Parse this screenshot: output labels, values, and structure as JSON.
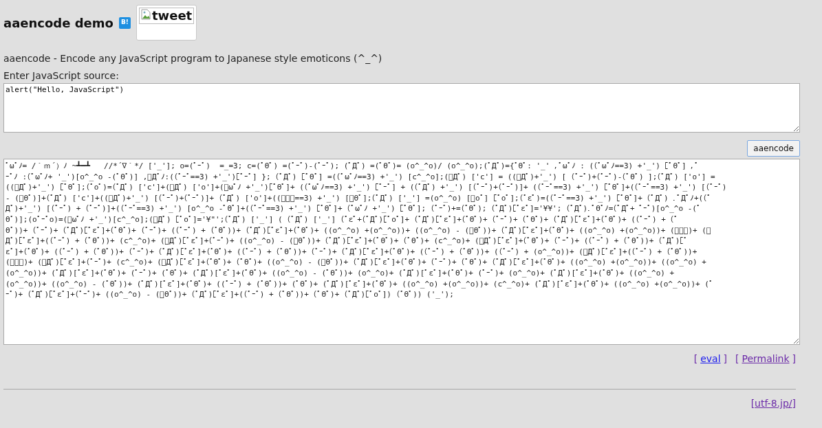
{
  "header": {
    "title": "aaencode demo",
    "bookmark_badge": "B!",
    "tweet_image_alt": "tweet"
  },
  "description": "aaencode - Encode any JavaScript program to Japanese style emoticons (^_^)",
  "source": {
    "label": "Enter JavaScript source:",
    "value": "alert(\"Hello, JavaScript\")"
  },
  "encode_button": "aaencode",
  "output": {
    "lines": [
      {
        "parts": [
          "ﾟωﾟﾉ= /｀ｍ´）ﾉ ~┻━┻   //*´∇｀",
          "*/ ['_']; o=(ﾟｰﾟ)  =_=3; c=(ﾟΘﾟ) =(ﾟｰﾟ)-(ﾟｰﾟ); (ﾟДﾟ) =(ﾟΘﾟ)= (o^_^o)/ (o^_^o);(ﾟДﾟ)={ﾟΘﾟ: '_' ,ﾟωﾟﾉ : ((ﾟωﾟﾉ==3) +'_') [ﾟΘﾟ] ,ﾟ"
        ]
      },
      {
        "parts": [
          "ｰﾟﾉ :(ﾟωﾟﾉ+ '_')[o^_^o -(ﾟΘﾟ)] ,ﾟДﾟﾉ:((ﾟｰﾟ==3) +'_')[ﾟｰﾟ] }; (ﾟДﾟ) [ﾟΘﾟ] =((ﾟωﾟﾉ==3) +'_') [c^_^o];(ﾟДﾟ) ['c'] = ((ﾟДﾟ)+'_') [ (ﾟｰﾟ)+(ﾟｰﾟ)-(ﾟΘﾟ) ];(ﾟДﾟ) ['o'] ="
        ]
      },
      {
        "parts": [
          "((ﾟДﾟ)+'_') [ﾟΘﾟ];(ﾟoﾟ)=(ﾟДﾟ) ['c']+(ﾟДﾟ) ['o']+(ﾟωﾟﾉ +'_')[ﾟΘﾟ]+ ((ﾟωﾟﾉ==3) +'_') [ﾟｰﾟ] + ((ﾟДﾟ) +'_') [(ﾟｰﾟ)+(ﾟｰﾟ)]+ ((ﾟｰﾟ==3) +'_') [ﾟΘﾟ]+((ﾟｰﾟ==3) +'_') [(ﾟｰﾟ)"
        ]
      },
      {
        "parts": [
          "- (ﾟΘﾟ)]+(ﾟДﾟ) ['c']+((ﾟДﾟ)+'_') [(ﾟｰﾟ)+(ﾟｰﾟ)]+ (ﾟДﾟ) ['o']+((ﾟｰﾟ==3) +'_') [ﾟΘﾟ];(ﾟДﾟ) ['_'] =(o^_^o) [ﾟoﾟ] [ﾟoﾟ];(ﾟεﾟ)=((ﾟｰﾟ==3) +'_') [ﾟΘﾟ]+ (ﾟДﾟ) .ﾟДﾟﾉ+((ﾟ"
        ]
      },
      {
        "parts": [
          "Дﾟ)+'_') [(ﾟｰﾟ) + (ﾟｰﾟ)]+((ﾟｰﾟ==3) +'_') [o^_^o -ﾟΘﾟ]+((ﾟｰﾟ==3) +'_') [ﾟΘﾟ]+ (ﾟωﾟﾉ +'_') [ﾟΘﾟ]; (ﾟｰﾟ)+=(ﾟΘﾟ);",
          " (ﾟДﾟ)[ﾟεﾟ]='¥¥'; (ﾟДﾟ).ﾟΘﾟﾉ=(ﾟДﾟ+ ",
          "ﾟｰﾟ)[o^_^o -(ﾟ"
        ]
      },
      {
        "parts": [
          "Θﾟ)];(oﾟｰﾟo)=(ﾟωﾟﾉ +'_')[c^_^o];(ﾟДﾟ) [ﾟoﾟ]='¥\"';(ﾟДﾟ) ['_'] ( (ﾟДﾟ) ['_'] (ﾟεﾟ+(ﾟДﾟ)[ﾟoﾟ]+ (ﾟДﾟ)[ﾟεﾟ]+(ﾟΘﾟ)+ (ﾟｰﾟ)+ (ﾟΘﾟ)+ (ﾟДﾟ)[ﾟεﾟ]+(ﾟΘﾟ)+ ((ﾟｰﾟ) + (ﾟ"
        ]
      },
      {
        "parts": [
          "Θﾟ))+ (ﾟｰﾟ)+ (ﾟДﾟ)[ﾟεﾟ]+(ﾟΘﾟ)+ (ﾟｰﾟ)+ ((ﾟｰﾟ) + (ﾟΘﾟ))+ (ﾟДﾟ)[ﾟεﾟ]+(ﾟΘﾟ)+ ((o^_^o) +(o^_^o))+ ((o^_^o) - (ﾟΘﾟ))+ (ﾟДﾟ)[ﾟεﾟ]+(ﾟΘﾟ)+ ((o^_^o) +(o^_^o))+ (ﾟｰﾟ)+ (ﾟ"
        ]
      },
      {
        "parts": [
          "Дﾟ)[ﾟεﾟ]+((ﾟｰﾟ) + (ﾟΘﾟ))+ (c^_^o)+ (ﾟДﾟ)[ﾟεﾟ]+(ﾟｰﾟ)+ ((o^_^o) - (ﾟΘﾟ))+ (ﾟДﾟ)[ﾟεﾟ]+(ﾟΘﾟ)+ (ﾟΘﾟ)+ (c^_^o)+ (ﾟДﾟ)[ﾟεﾟ]+(ﾟΘﾟ)+ (ﾟｰﾟ)+ ((ﾟｰﾟ) + (ﾟΘﾟ))+ (ﾟДﾟ)[ﾟ"
        ]
      },
      {
        "parts": [
          "εﾟ]+(ﾟΘﾟ)+ ((ﾟｰﾟ) + (ﾟΘﾟ))+ (ﾟｰﾟ)+ (ﾟДﾟ)[ﾟεﾟ]+(ﾟΘﾟ)+ ((ﾟｰﾟ) + (ﾟΘﾟ))+ (ﾟｰﾟ)+ (ﾟДﾟ)[ﾟεﾟ]+(ﾟΘﾟ)+ ((ﾟｰﾟ) + (ﾟΘﾟ))+ ((ﾟｰﾟ) + (o^_^o))+ (ﾟДﾟ)[ﾟεﾟ]+((ﾟｰﾟ) + (ﾟΘﾟ))+"
        ]
      },
      {
        "parts": [
          "(ﾟｰﾟ)+ (ﾟДﾟ)[ﾟεﾟ]+(ﾟｰﾟ)+ (c^_^o)+ (ﾟДﾟ)[ﾟεﾟ]+(ﾟΘﾟ)+ (ﾟΘﾟ)+ ((o^_^o) - (ﾟΘﾟ))+ (ﾟДﾟ)[ﾟεﾟ]+(ﾟΘﾟ)+ (ﾟｰﾟ)+ (ﾟΘﾟ)+ (ﾟДﾟ)[ﾟεﾟ]+(ﾟΘﾟ)+ ((o^_^o) +(o^_^o))+ ((o^_^o) +"
        ]
      },
      {
        "parts": [
          "(o^_^o))+ (ﾟДﾟ)[ﾟεﾟ]+(ﾟΘﾟ)+ (ﾟｰﾟ)+ (ﾟΘﾟ)+ (ﾟДﾟ)[ﾟεﾟ]+(ﾟΘﾟ)+ ((o^_^o) - (ﾟΘﾟ))+ (o^_^o)+ (ﾟДﾟ)[ﾟεﾟ]+(ﾟΘﾟ)+ (ﾟｰﾟ)+ (o^_^o)+ (ﾟДﾟ)[ﾟεﾟ]+(ﾟΘﾟ)+ ((o^_^o) +"
        ]
      },
      {
        "parts": [
          "(o^_^o))+ ((o^_^o) - (ﾟΘﾟ))+ (ﾟДﾟ)[ﾟεﾟ]+(ﾟΘﾟ)+ ((ﾟｰﾟ) + (ﾟΘﾟ))+ (ﾟΘﾟ)+ (ﾟДﾟ)[ﾟεﾟ]+(ﾟΘﾟ)+ ((o^_^o) +(o^_^o))+ (c^_^o)+ (ﾟДﾟ)[ﾟεﾟ]+(ﾟΘﾟ)+ ((o^_^o) +(o^_^o))+ (ﾟ"
        ]
      },
      {
        "parts": [
          "ｰﾟ)+ (ﾟДﾟ)[ﾟεﾟ]+(ﾟｰﾟ)+ ((o^_^o) - (ﾟΘﾟ))+ (ﾟДﾟ)[ﾟεﾟ]+((ﾟｰﾟ) + (ﾟΘﾟ))+ (ﾟΘﾟ)+ (ﾟДﾟ)[ﾟoﾟ]) (ﾟΘﾟ)) ('_');"
        ]
      }
    ]
  },
  "links": [
    {
      "prefix": "[",
      "label": "eval",
      "suffix": "]",
      "visited": false
    },
    {
      "prefix": "[",
      "label": "Permalink",
      "suffix": "]",
      "visited": true
    }
  ],
  "footer": {
    "prefix": "[",
    "label": "utf-8.jp/",
    "suffix": "]",
    "visited": true
  }
}
